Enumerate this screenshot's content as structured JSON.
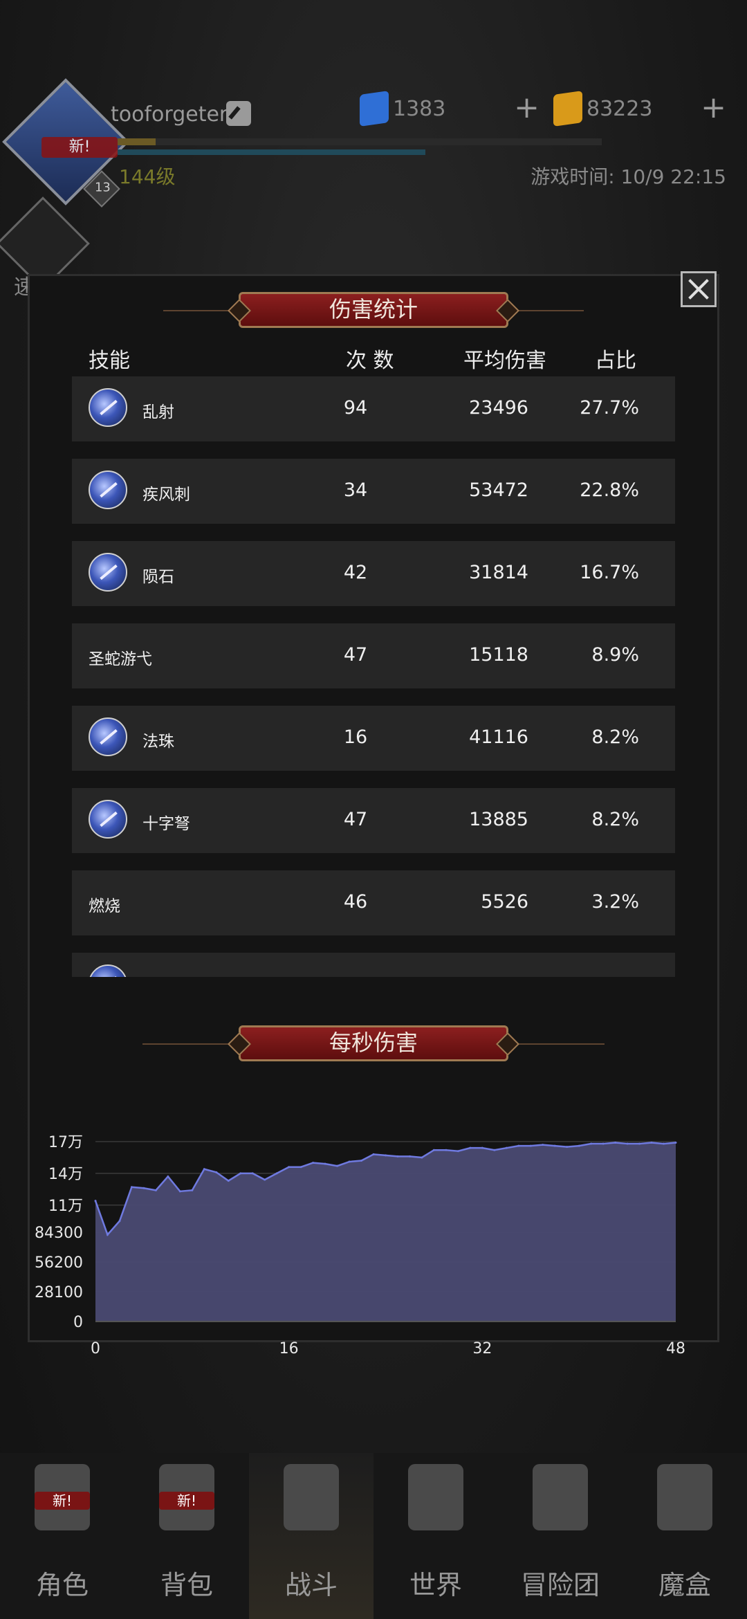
{
  "header": {
    "username": "tooforgeter",
    "level": "144级",
    "avatar_badge_new": "新!",
    "avatar_rank": "13",
    "gems": "1383",
    "gold": "83223",
    "game_time": "游戏时间: 10/9 22:15",
    "quick_battle_label": "速 战"
  },
  "colors": {
    "gem": "#2f6fd6",
    "gold": "#d99a1a",
    "banner": "#8c1f1f",
    "chart_fill": "#4a4a72",
    "chart_line": "#6f7ae0"
  },
  "panel": {
    "title": "伤害统计",
    "columns": {
      "skill": "技能",
      "count": "次 数",
      "avg": "平均伤害",
      "share": "占比"
    },
    "rows": [
      {
        "name": "乱射",
        "count": "94",
        "avg": "23496",
        "share": "27.7%",
        "icon": "arrow-volley-icon"
      },
      {
        "name": "疾风刺",
        "count": "34",
        "avg": "53472",
        "share": "22.8%",
        "icon": "gale-thrust-icon"
      },
      {
        "name": "陨石",
        "count": "42",
        "avg": "31814",
        "share": "16.7%",
        "icon": "meteor-icon"
      },
      {
        "name": "圣蛇游弋",
        "count": "47",
        "avg": "15118",
        "share": "8.9%",
        "icon": ""
      },
      {
        "name": "法珠",
        "count": "16",
        "avg": "41116",
        "share": "8.2%",
        "icon": "magic-orb-icon"
      },
      {
        "name": "十字弩",
        "count": "47",
        "avg": "13885",
        "share": "8.2%",
        "icon": "crossbow-icon"
      },
      {
        "name": "燃烧",
        "count": "46",
        "avg": "5526",
        "share": "3.2%",
        "icon": ""
      },
      {
        "name": "",
        "count": "",
        "avg": "",
        "share": "",
        "icon": "skill-icon"
      }
    ]
  },
  "dps": {
    "title": "每秒伤害"
  },
  "chart_data": {
    "type": "area",
    "title": "每秒伤害",
    "xlabel": "",
    "ylabel": "",
    "x_ticks": [
      "0",
      "16",
      "32",
      "48"
    ],
    "y_ticks": [
      "0",
      "28100",
      "56200",
      "84300",
      "11万",
      "14万",
      "17万"
    ],
    "xlim": [
      0,
      48
    ],
    "ylim": [
      0,
      170000
    ],
    "grid": true,
    "x": [
      0,
      1,
      2,
      3,
      4,
      5,
      6,
      7,
      8,
      9,
      10,
      11,
      12,
      13,
      14,
      15,
      16,
      17,
      18,
      19,
      20,
      21,
      22,
      23,
      24,
      25,
      26,
      27,
      28,
      29,
      30,
      31,
      32,
      33,
      34,
      35,
      36,
      37,
      38,
      39,
      40,
      41,
      42,
      43,
      44,
      45,
      46,
      47,
      48
    ],
    "values": [
      114000,
      82000,
      95000,
      127000,
      126000,
      124000,
      137000,
      123000,
      124000,
      144000,
      141000,
      133000,
      140000,
      140000,
      134000,
      140000,
      146000,
      146000,
      150000,
      149000,
      147000,
      151000,
      152000,
      158000,
      157000,
      156000,
      156000,
      155000,
      162000,
      162000,
      161000,
      164000,
      164000,
      162000,
      164000,
      166000,
      166000,
      167000,
      166000,
      165000,
      166000,
      168000,
      168000,
      169000,
      168000,
      168000,
      169000,
      168000,
      169000
    ]
  },
  "nav": {
    "items": [
      {
        "label": "角色",
        "icon": "helmet-icon",
        "badge": "新!"
      },
      {
        "label": "背包",
        "icon": "backpack-icon",
        "badge": "新!"
      },
      {
        "label": "战斗",
        "icon": "sword-shield-icon",
        "badge": ""
      },
      {
        "label": "世界",
        "icon": "map-scroll-icon",
        "badge": ""
      },
      {
        "label": "冒险团",
        "icon": "castle-icon",
        "badge": ""
      },
      {
        "label": "魔盒",
        "icon": "cube-icon",
        "badge": ""
      }
    ]
  }
}
